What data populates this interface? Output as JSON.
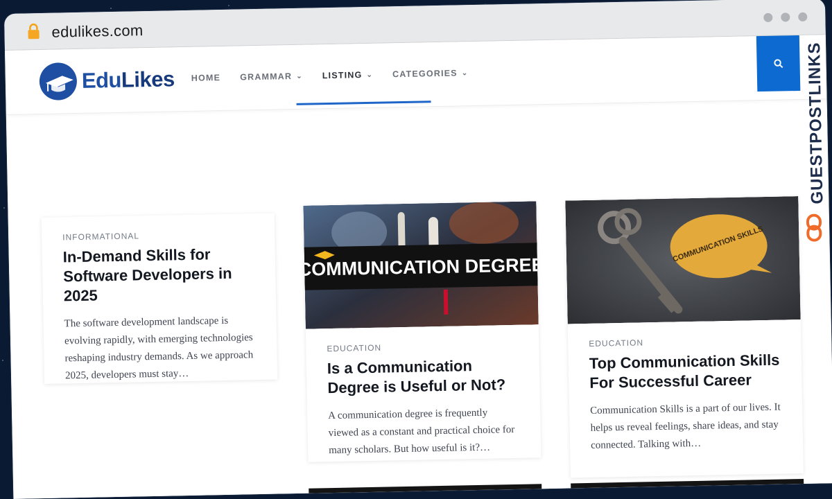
{
  "browser": {
    "url": "edulikes.com"
  },
  "site": {
    "logo": {
      "part1": "Edu",
      "part2": "Likes"
    },
    "nav": [
      {
        "label": "HOME",
        "has_dropdown": false
      },
      {
        "label": "GRAMMAR",
        "has_dropdown": true
      },
      {
        "label": "LISTING",
        "has_dropdown": true
      },
      {
        "label": "CATEGORIES",
        "has_dropdown": true
      }
    ],
    "search_icon": "search-icon",
    "side_badge": "GUESTPOSTLINKS"
  },
  "posts": [
    {
      "category": "INFORMATIONAL",
      "title": "In-Demand Skills for Software Developers in 2025",
      "excerpt": "The software development landscape is evolving rapidly, with emerging technologies reshaping industry demands. As we approach 2025, developers must stay…"
    },
    {
      "category": "EDUCATION",
      "title": "Is a Communication Degree is Useful or Not?",
      "excerpt": "A communication degree is frequently viewed as a constant and practical choice for many scholars. But how useful is it?…",
      "image_text": "COMMUNICATION DEGREE"
    },
    {
      "category": "EDUCATION",
      "title": "Top Communication Skills For Successful Career",
      "excerpt": "Communication Skills is a part of our lives. It helps us reveal feelings, share ideas, and stay connected. Talking with…",
      "image_text": "COMMUNICATION SKILLS"
    }
  ],
  "colors": {
    "accent": "#0d6ad0",
    "brand": "#1e4fa3",
    "badge_orange": "#f06a2a"
  }
}
